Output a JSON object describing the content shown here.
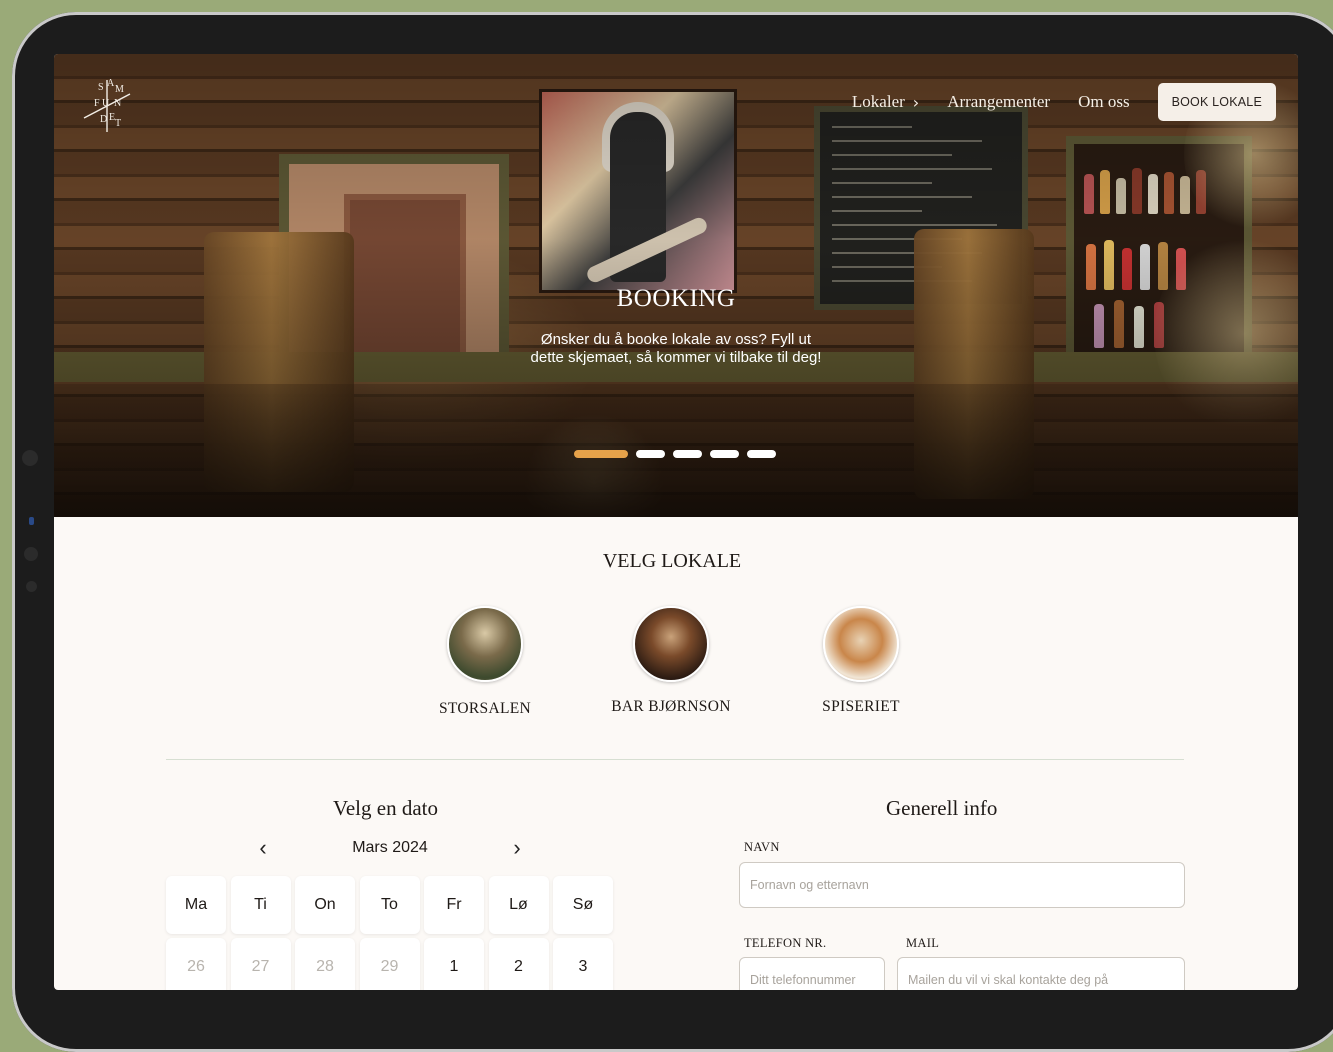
{
  "nav": {
    "logo_text": "SAMFUNDET",
    "items": [
      {
        "label": "Lokaler",
        "chevron": "›"
      },
      {
        "label": "Arrangementer"
      },
      {
        "label": "Om oss"
      }
    ],
    "cta_label": "BOOK LOKALE"
  },
  "hero": {
    "title": "BOOKING",
    "subtitle": "Ønsker du å booke lokale av oss? Fyll ut dette skjemaet, så kommer vi tilbake til deg!",
    "carousel": {
      "slides": 5,
      "active": 1,
      "active_color": "#e6a24a"
    }
  },
  "venues": {
    "title": "VELG LOKALE",
    "items": [
      {
        "label": "STORSALEN"
      },
      {
        "label": "BAR BJØRNSON"
      },
      {
        "label": "SPISERIET"
      }
    ]
  },
  "calendar": {
    "title": "Velg en dato",
    "month": "Mars 2024",
    "prev": "‹",
    "next": "›",
    "weekdays": [
      "Ma",
      "Ti",
      "On",
      "To",
      "Fr",
      "Lø",
      "Sø"
    ],
    "days": [
      {
        "d": "26",
        "muted": true
      },
      {
        "d": "27",
        "muted": true
      },
      {
        "d": "28",
        "muted": true
      },
      {
        "d": "29",
        "muted": true
      },
      {
        "d": "1",
        "muted": false
      },
      {
        "d": "2",
        "muted": false
      },
      {
        "d": "3",
        "muted": false
      }
    ]
  },
  "info": {
    "title": "Generell info",
    "name_label": "NAVN",
    "name_placeholder": "Fornavn og etternavn",
    "phone_label": "TELEFON NR.",
    "phone_placeholder": "Ditt telefonnummer",
    "mail_label": "MAIL",
    "mail_placeholder": "Mailen du vil vi skal kontakte deg på"
  },
  "colors": {
    "accent": "#e6a24a",
    "background": "#fcf9f6",
    "frame": "#9aaa78"
  }
}
